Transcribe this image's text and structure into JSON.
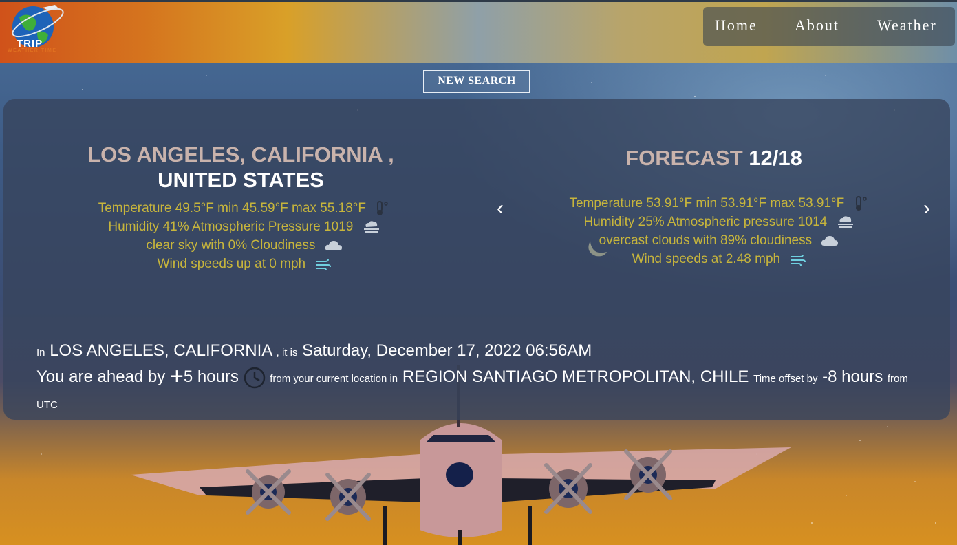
{
  "header": {
    "logo_text": "TRIP",
    "logo_subtext": "WEATHER TIME",
    "nav": [
      {
        "label": "Home"
      },
      {
        "label": "About"
      },
      {
        "label": "Weather"
      }
    ]
  },
  "search": {
    "new_search_label": "NEW SEARCH"
  },
  "current": {
    "city_line1": "LOS ANGELES, CALIFORNIA ,",
    "city_line2": "UNITED STATES",
    "temperature": "Temperature 49.5°F min 45.59°F max 55.18°F",
    "humidity": "Humidity 41% Atmospheric Pressure 1019",
    "sky": "clear sky with 0% Cloudiness",
    "wind": "Wind speeds up at 0 mph"
  },
  "forecast": {
    "title_word": "FORECAST",
    "date": "12/18",
    "temperature": "Temperature 53.91°F min 53.91°F max 53.91°F",
    "humidity": "Humidity 25% Atmospheric pressure 1014",
    "sky": "overcast clouds with 89% cloudiness",
    "wind": "Wind speeds at 2.48 mph",
    "prev_arrow": "‹",
    "next_arrow": "›"
  },
  "time_info": {
    "in_label": "In",
    "city": "LOS ANGELES, CALIFORNIA",
    "it_is_label": ", it is",
    "datetime": "Saturday, December 17, 2022 06:56AM",
    "ahead_label": "You are ahead by",
    "plus_sign": "+",
    "offset_hours": "5 hours",
    "from_location_label": "from your current location in",
    "current_location": "REGION SANTIAGO METROPOLITAN, CHILE",
    "time_offset_label": "Time offset by",
    "utc_offset": "-8 hours",
    "from_utc_label": "from UTC"
  },
  "colors": {
    "info_text": "#c7b53c",
    "city_text": "#c9b3ac",
    "panel": "#37445c",
    "icon_cyan": "#6fd0e0"
  },
  "icons": [
    "thermometer-icon",
    "fog-icon",
    "cloud-icon",
    "wind-icon",
    "clock-icon",
    "globe-plane-icon"
  ]
}
